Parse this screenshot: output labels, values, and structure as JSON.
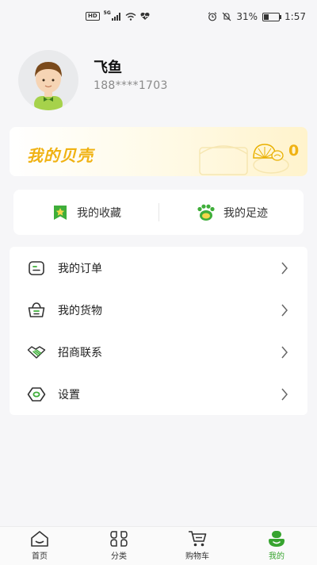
{
  "status_bar": {
    "hd_badge": "HD",
    "network": "5G",
    "battery": "31%",
    "battery_level": 0.31,
    "time": "1:57"
  },
  "profile": {
    "name": "飞鱼",
    "phone": "188****1703"
  },
  "shells": {
    "title": "我的贝壳",
    "count": "0"
  },
  "quick_links": [
    {
      "label": "我的收藏",
      "icon": "star-bookmark-icon"
    },
    {
      "label": "我的足迹",
      "icon": "footprint-icon"
    }
  ],
  "menu": [
    {
      "label": "我的订单",
      "icon": "order-icon"
    },
    {
      "label": "我的货物",
      "icon": "basket-icon"
    },
    {
      "label": "招商联系",
      "icon": "handshake-icon"
    },
    {
      "label": "设置",
      "icon": "settings-icon"
    }
  ],
  "bottom_nav": [
    {
      "label": "首页",
      "icon": "home-icon"
    },
    {
      "label": "分类",
      "icon": "category-icon"
    },
    {
      "label": "购物车",
      "icon": "cart-icon"
    },
    {
      "label": "我的",
      "icon": "profile-icon",
      "active": true
    }
  ],
  "colors": {
    "accent_green": "#37a42f",
    "shell_gold": "#f0b213",
    "page_bg": "#f6f6f8"
  }
}
